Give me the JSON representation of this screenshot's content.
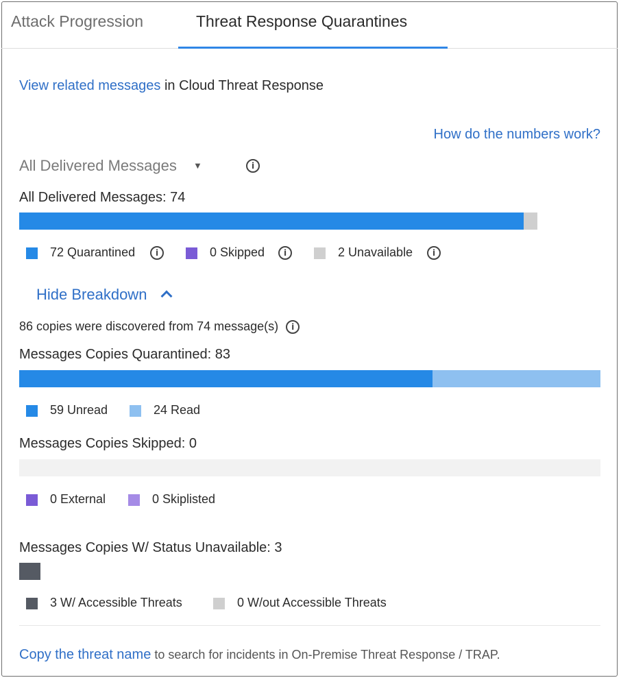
{
  "tabs": [
    {
      "label": "Attack Progression"
    },
    {
      "label": "Threat Response Quarantines"
    }
  ],
  "related": {
    "link": "View related messages",
    "rest": "in Cloud Threat Response"
  },
  "help_link": "How do the numbers work?",
  "filter": {
    "selected": "All Delivered Messages"
  },
  "delivered": {
    "title": "All Delivered Messages: 74",
    "total": 74,
    "quarantined": 72,
    "skipped": 0,
    "unavailable": 2,
    "legend": {
      "quarantined": "72 Quarantined",
      "skipped": "0 Skipped",
      "unavailable": "2 Unavailable"
    }
  },
  "breakdown_toggle": "Hide Breakdown",
  "copies_note": "86 copies were discovered from 74 message(s)",
  "copies_quarantined": {
    "title": "Messages Copies Quarantined: 83",
    "unread": 59,
    "read": 24,
    "legend": {
      "unread": "59 Unread",
      "read": "24 Read"
    }
  },
  "copies_skipped": {
    "title": "Messages Copies Skipped: 0",
    "external": 0,
    "skiplisted": 0,
    "legend": {
      "external": "0 External",
      "skiplisted": "0 Skiplisted"
    }
  },
  "copies_unavailable": {
    "title": "Messages Copies W/ Status Unavailable: 3",
    "accessible": 3,
    "not_accessible": 0,
    "legend": {
      "accessible": "3 W/ Accessible Threats",
      "not_accessible": "0 W/out Accessible Threats"
    }
  },
  "footer": {
    "link": "Copy the threat name",
    "rest": "to search for incidents in On-Premise Threat Response / TRAP."
  },
  "colors": {
    "quarantined": "#2589e6",
    "read": "#8ec0f0",
    "skipped": "#7a5bd6",
    "skiplisted": "#a58be6",
    "unavailable": "#cfcfcf",
    "accessible": "#555a63",
    "link": "#2f6fc7"
  }
}
